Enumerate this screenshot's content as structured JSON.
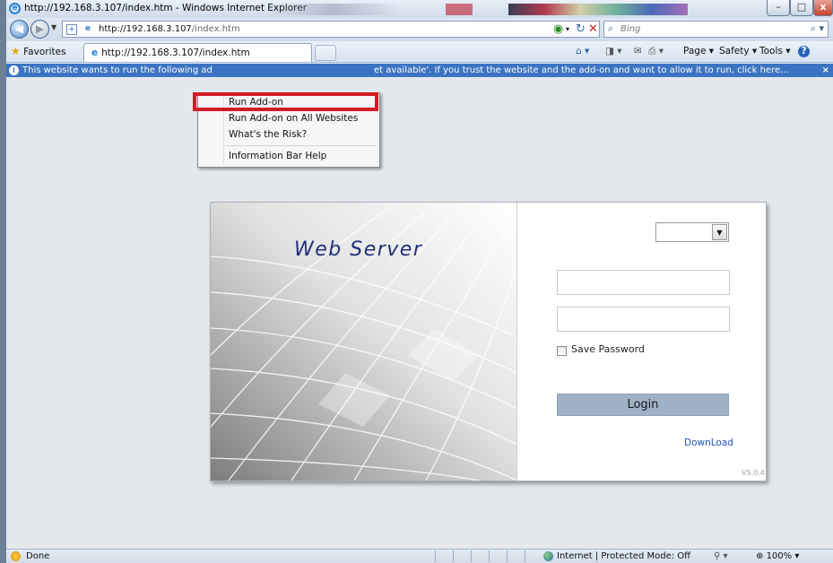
{
  "window": {
    "title": "http://192.168.3.107/index.htm - Windows Internet Explorer",
    "minimize": "–",
    "maximize": "□",
    "close": "x"
  },
  "address_bar": {
    "url_host": "http://192.168.3.107",
    "url_path": "/index.htm",
    "refresh_icon": "↻",
    "stop_icon": "✕"
  },
  "search": {
    "placeholder": "Bing"
  },
  "favorites": {
    "label": "Favorites"
  },
  "tab": {
    "title": "http://192.168.3.107/index.htm"
  },
  "command_bar": {
    "page": "Page ▾",
    "safety": "Safety ▾",
    "tools": "Tools ▾",
    "help": "?"
  },
  "infobar": {
    "text_start": "This website wants to run the following ad",
    "text_end": "et available'. If you trust the website and the add-on and want to allow it to run, click here...",
    "close": "×"
  },
  "context_menu": {
    "items": [
      "Run Add-on",
      "Run Add-on on All Websites",
      "What's the Risk?",
      "Information Bar Help"
    ]
  },
  "login_panel": {
    "brand": "Web Server",
    "language_value": "",
    "username_value": "",
    "password_value": "",
    "save_password_label": "Save Password",
    "save_password_checked": false,
    "login_label": "Login",
    "download_label": "DownLoad",
    "version": "V5.0.4"
  },
  "status_bar": {
    "status_text": "Done",
    "zone_text": "Internet | Protected Mode: Off",
    "zoom": "100%"
  },
  "colors": {
    "infobar_bg": "#3b74c2",
    "highlight_border": "#d31b25",
    "login_button_bg": "#9eb1c6",
    "brand_text": "#1f2f78",
    "download_link": "#2454b8"
  }
}
